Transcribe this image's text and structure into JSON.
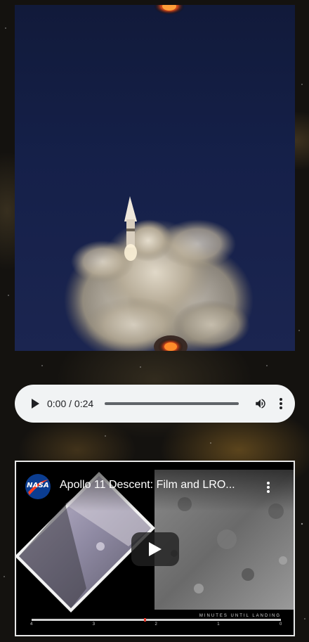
{
  "launch_image": {
    "description_icon": "rocket-launch-photo"
  },
  "audio": {
    "current_time": "0:00",
    "separator": " / ",
    "duration": "0:24",
    "progress": 0,
    "play_icon": "play-icon",
    "volume_icon": "volume-icon",
    "menu_icon": "more-vert-icon"
  },
  "video": {
    "channel_logo_text": "NASA",
    "title": "Apollo 11 Descent: Film and LRO...",
    "play_icon": "youtube-play-icon",
    "menu_icon": "more-vert-icon",
    "timeline_label": "MINUTES UNTIL LANDING",
    "timeline_ticks": [
      "4",
      "3",
      "2",
      "1",
      "0"
    ],
    "timeline_progress": 0.45
  },
  "colors": {
    "audio_bg": "#f1f3f4",
    "sky": "#152049",
    "nasa_blue": "#0b3d91",
    "nasa_red": "#e23b2e"
  }
}
